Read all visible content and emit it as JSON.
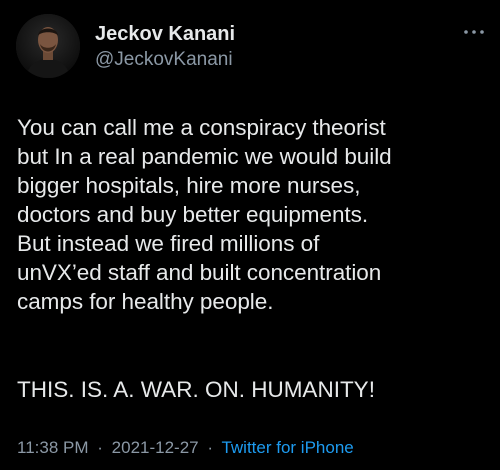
{
  "author": {
    "display_name": "Jeckov Kanani",
    "handle": "@JeckovKanani"
  },
  "tweet": {
    "lines": [
      "You can call me a conspiracy theorist",
      "but In a real pandemic we would build",
      "bigger hospitals, hire more nurses,",
      "doctors and buy better equipments.",
      "But instead we fired millions of",
      "unVX’ed staff and built concentration",
      "camps for healthy people."
    ],
    "closing": "THIS. IS. A. WAR. ON. HUMANITY!"
  },
  "meta": {
    "time": "11:38 PM",
    "separator": "·",
    "date": "2021-12-27",
    "source": "Twitter for iPhone"
  },
  "icons": {
    "more": "more-options-icon",
    "avatar": "avatar"
  },
  "colors": {
    "background": "#000000",
    "text": "#e7e9ea",
    "secondary": "#8b98a5",
    "accent": "#1d9bf0"
  }
}
